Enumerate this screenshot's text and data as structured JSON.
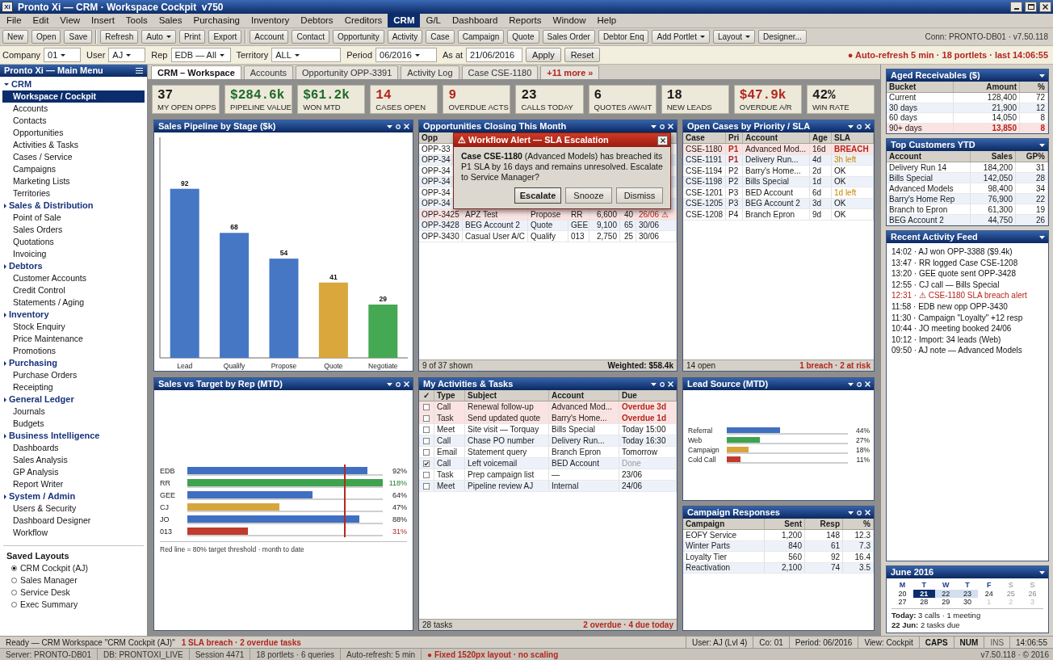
{
  "window": {
    "logo": "Xi",
    "title": "Pronto Xi — CRM · Workspace Cockpit  v750"
  },
  "menu": [
    {
      "label": "File",
      "selected": false
    },
    {
      "label": "Edit",
      "selected": false
    },
    {
      "label": "View",
      "selected": false
    },
    {
      "label": "Insert",
      "selected": false
    },
    {
      "label": "Tools",
      "selected": false
    },
    {
      "label": "Sales",
      "selected": false
    },
    {
      "label": "Purchasing",
      "selected": false
    },
    {
      "label": "Inventory",
      "selected": false
    },
    {
      "label": "Debtors",
      "selected": false
    },
    {
      "label": "Creditors",
      "selected": false
    },
    {
      "label": "CRM",
      "selected": true
    },
    {
      "label": "G/L",
      "selected": false
    },
    {
      "label": "Dashboard",
      "selected": false
    },
    {
      "label": "Reports",
      "selected": false
    },
    {
      "label": "Window",
      "selected": false
    },
    {
      "label": "Help",
      "selected": false
    }
  ],
  "toolbar": {
    "groups": [
      [
        {
          "label": "New",
          "dropdown": false
        },
        {
          "label": "Open",
          "dropdown": false
        },
        {
          "label": "Save",
          "dropdown": false
        }
      ],
      [
        {
          "label": "Refresh",
          "dropdown": false
        },
        {
          "label": "Auto",
          "dropdown": true
        },
        {
          "label": "Print",
          "dropdown": false
        },
        {
          "label": "Export",
          "dropdown": false
        }
      ],
      [
        {
          "label": "Account",
          "dropdown": false
        },
        {
          "label": "Contact",
          "dropdown": false
        },
        {
          "label": "Opportunity",
          "dropdown": false
        },
        {
          "label": "Activity",
          "dropdown": false
        },
        {
          "label": "Case",
          "dropdown": false
        },
        {
          "label": "Campaign",
          "dropdown": false
        },
        {
          "label": "Quote",
          "dropdown": false
        },
        {
          "label": "Sales Order",
          "dropdown": false
        },
        {
          "label": "Debtor Enq",
          "dropdown": false
        },
        {
          "label": "Add Portlet",
          "dropdown": true
        },
        {
          "label": "Layout",
          "dropdown": true
        },
        {
          "label": "Designer...",
          "dropdown": false
        }
      ]
    ],
    "connection": "Conn: PRONTO-DB01 · v7.50.118"
  },
  "filters": {
    "fields": [
      {
        "label": "Company",
        "value": "01",
        "kind": "select"
      },
      {
        "label": "User",
        "value": "AJ",
        "kind": "select"
      },
      {
        "label": "Rep",
        "value": "EDB — All",
        "kind": "select"
      },
      {
        "label": "Territory",
        "value": "ALL",
        "kind": "select"
      },
      {
        "label": "Period",
        "value": "06/2016",
        "kind": "select"
      },
      {
        "label": "As at",
        "value": "21/06/2016",
        "kind": "input"
      }
    ],
    "buttons": [
      "Apply",
      "Reset"
    ],
    "status": "● Auto-refresh 5 min · 18 portlets · last 14:06:55"
  },
  "sidebar": {
    "title": "Pronto Xi — Main Menu",
    "groups": [
      {
        "label": "CRM",
        "expanded": true,
        "children": [
          {
            "label": "Workspace / Cockpit",
            "selected": true
          },
          {
            "label": "Accounts",
            "selected": false
          },
          {
            "label": "Contacts",
            "selected": false
          },
          {
            "label": "Opportunities",
            "selected": false
          },
          {
            "label": "Activities & Tasks",
            "selected": false
          },
          {
            "label": "Cases / Service",
            "selected": false
          },
          {
            "label": "Campaigns",
            "selected": false
          },
          {
            "label": "Marketing Lists",
            "selected": false
          },
          {
            "label": "Territories",
            "selected": false
          }
        ]
      },
      {
        "label": "Sales & Distribution",
        "expanded": false,
        "children": [
          {
            "label": "Point of Sale",
            "selected": false
          },
          {
            "label": "Sales Orders",
            "selected": false
          },
          {
            "label": "Quotations",
            "selected": false
          },
          {
            "label": "Invoicing",
            "selected": false
          }
        ]
      },
      {
        "label": "Debtors",
        "expanded": false,
        "children": [
          {
            "label": "Customer Accounts",
            "selected": false
          },
          {
            "label": "Credit Control",
            "selected": false
          },
          {
            "label": "Statements / Aging",
            "selected": false
          }
        ]
      },
      {
        "label": "Inventory",
        "expanded": false,
        "children": [
          {
            "label": "Stock Enquiry",
            "selected": false
          },
          {
            "label": "Price Maintenance",
            "selected": false
          },
          {
            "label": "Promotions",
            "selected": false
          }
        ]
      },
      {
        "label": "Purchasing",
        "expanded": false,
        "children": [
          {
            "label": "Purchase Orders",
            "selected": false
          },
          {
            "label": "Receipting",
            "selected": false
          }
        ]
      },
      {
        "label": "General Ledger",
        "expanded": false,
        "children": [
          {
            "label": "Journals",
            "selected": false
          },
          {
            "label": "Budgets",
            "selected": false
          }
        ]
      },
      {
        "label": "Business Intelligence",
        "expanded": false,
        "children": [
          {
            "label": "Dashboards",
            "selected": false
          },
          {
            "label": "Sales Analysis",
            "selected": false
          },
          {
            "label": "GP Analysis",
            "selected": false
          },
          {
            "label": "Report Writer",
            "selected": false
          }
        ]
      },
      {
        "label": "System / Admin",
        "expanded": false,
        "children": [
          {
            "label": "Users & Security",
            "selected": false
          },
          {
            "label": "Dashboard Designer",
            "selected": false
          },
          {
            "label": "Workflow",
            "selected": false
          }
        ]
      }
    ],
    "saved_layouts": {
      "title": "Saved Layouts",
      "items": [
        {
          "label": "CRM Cockpit (AJ)",
          "selected": true
        },
        {
          "label": "Sales Manager",
          "selected": false
        },
        {
          "label": "Service Desk",
          "selected": false
        },
        {
          "label": "Exec Summary",
          "selected": false
        }
      ]
    }
  },
  "tabs": [
    {
      "label": "CRM – Workspace",
      "selected": true
    },
    {
      "label": "Accounts",
      "selected": false
    },
    {
      "label": "Opportunity OPP-3391",
      "selected": false
    },
    {
      "label": "Activity Log",
      "selected": false
    },
    {
      "label": "Case CSE-1180",
      "selected": false
    }
  ],
  "tabs_more": "+11 more »",
  "kpis": [
    {
      "value": "37",
      "label": "MY OPEN OPPS",
      "color": "#1a1a1a"
    },
    {
      "value": "$284.6k",
      "label": "PIPELINE VALUE",
      "color": "#1e6b2a"
    },
    {
      "value": "$61.2k",
      "label": "WON MTD",
      "color": "#1e6b2a"
    },
    {
      "value": "14",
      "label": "CASES OPEN",
      "color": "#b3261e"
    },
    {
      "value": "9",
      "label": "OVERDUE ACTS",
      "color": "#b3261e"
    },
    {
      "value": "23",
      "label": "CALLS TODAY",
      "color": "#1a1a1a"
    },
    {
      "value": "6",
      "label": "QUOTES AWAIT",
      "color": "#1a1a1a"
    },
    {
      "value": "18",
      "label": "NEW LEADS",
      "color": "#1a1a1a"
    },
    {
      "value": "$47.9k",
      "label": "OVERDUE A/R",
      "color": "#b3261e"
    },
    {
      "value": "42%",
      "label": "WIN RATE",
      "color": "#1a1a1a"
    }
  ],
  "pipeline": {
    "title": "Sales Pipeline by Stage ($k)",
    "bars": [
      {
        "color": "#4677c4"
      },
      {
        "color": "#4677c4"
      },
      {
        "color": "#4677c4"
      },
      {
        "color": "#d9a73c"
      },
      {
        "color": "#45a853"
      }
    ],
    "chart_data": {
      "type": "bar",
      "categories": [
        "Lead",
        "Qualify",
        "Propose",
        "Quote",
        "Negotiate"
      ],
      "values": [
        92,
        68,
        54,
        41,
        29
      ],
      "ylim": [
        0,
        120
      ],
      "data_labels": true
    }
  },
  "opportunities": {
    "title": "Opportunities Closing This Month",
    "columns": [
      "Opp"
    ],
    "rows": [
      {
        "cells": [
          "OPP-33"
        ],
        "overdue": false
      },
      {
        "cells": [
          "OPP-34"
        ],
        "overdue": false
      },
      {
        "cells": [
          "OPP-34"
        ],
        "overdue": false
      },
      {
        "cells": [
          "OPP-34"
        ],
        "overdue": false
      },
      {
        "cells": [
          "OPP-34"
        ],
        "overdue": false
      },
      {
        "cells": [
          "OPP-34"
        ],
        "overdue": false
      },
      {
        "cells": [
          "OPP-3425",
          "APZ Test",
          "Propose",
          "RR",
          "6,600",
          "40",
          "26/06 ⚠"
        ],
        "overdue": true
      },
      {
        "cells": [
          "OPP-3428",
          "BEG Account 2",
          "Quote",
          "GEE",
          "9,100",
          "65",
          "30/06"
        ],
        "overdue": false
      },
      {
        "cells": [
          "OPP-3430",
          "Casual User A/C",
          "Qualify",
          "013",
          "2,750",
          "25",
          "30/06"
        ],
        "overdue": false
      }
    ],
    "footer_left": "9 of 37 shown",
    "footer_right": "Weighted: $58.4k",
    "footer_alert": false
  },
  "alert": {
    "title": "⚠ Workflow Alert — SLA Escalation",
    "message": "**Case CSE-1180** (Advanced Models) has breached its P1 SLA by 16 days and remains unresolved. Escalate to Service Manager?",
    "buttons": [
      {
        "label": "Escalate",
        "default": true
      },
      {
        "label": "Snooze",
        "default": false
      },
      {
        "label": "Dismiss",
        "default": false
      }
    ]
  },
  "cases": {
    "title": "Open Cases by Priority / SLA",
    "columns": [
      "Case",
      "Pri",
      "Account",
      "Age",
      "SLA"
    ],
    "rows": [
      {
        "cells": [
          "CSE-1180",
          "P1",
          "Advanced Mod...",
          "16d",
          "BREACH"
        ],
        "urgent": true,
        "breached": true,
        "at_risk": false
      },
      {
        "cells": [
          "CSE-1191",
          "P1",
          "Delivery Run...",
          "4d",
          "3h left"
        ],
        "urgent": true,
        "breached": false,
        "at_risk": true
      },
      {
        "cells": [
          "CSE-1194",
          "P2",
          "Barry's Home...",
          "2d",
          "OK"
        ],
        "urgent": false,
        "breached": false,
        "at_risk": false
      },
      {
        "cells": [
          "CSE-1198",
          "P2",
          "Bills Special",
          "1d",
          "OK"
        ],
        "urgent": false,
        "breached": false,
        "at_risk": false
      },
      {
        "cells": [
          "CSE-1201",
          "P3",
          "BED Account",
          "6d",
          "1d left"
        ],
        "urgent": false,
        "breached": false,
        "at_risk": true
      },
      {
        "cells": [
          "CSE-1205",
          "P3",
          "BEG Account 2",
          "3d",
          "OK"
        ],
        "urgent": false,
        "breached": false,
        "at_risk": false
      },
      {
        "cells": [
          "CSE-1208",
          "P4",
          "Branch Epron",
          "9d",
          "OK"
        ],
        "urgent": false,
        "breached": false,
        "at_risk": false
      }
    ],
    "footer_left": "14 open",
    "footer_right": "1 breach · 2 at risk",
    "footer_alert": true
  },
  "sales_target": {
    "title": "Sales vs Target by Rep (MTD)",
    "target": {
      "level": 0.8
    },
    "reps": [
      {
        "name": "EDB",
        "level": 0.92,
        "reading": "92%",
        "color": "#3f6fc1",
        "over_target": false,
        "critical": false
      },
      {
        "name": "RR",
        "level": 1,
        "reading": "118%",
        "color": "#3ea34e",
        "over_target": true,
        "critical": false
      },
      {
        "name": "GEE",
        "level": 0.64,
        "reading": "64%",
        "color": "#3f6fc1",
        "over_target": false,
        "critical": false
      },
      {
        "name": "CJ",
        "level": 0.47,
        "reading": "47%",
        "color": "#d8a53c",
        "over_target": false,
        "critical": false
      },
      {
        "name": "JO",
        "level": 0.88,
        "reading": "88%",
        "color": "#3f6fc1",
        "over_target": false,
        "critical": false
      },
      {
        "name": "013",
        "level": 0.31,
        "reading": "31%",
        "color": "#c03a2e",
        "over_target": false,
        "critical": true
      }
    ],
    "note": "Red line = 80% target threshold · month to date"
  },
  "activities": {
    "title": "My Activities & Tasks",
    "check_header": "✓",
    "columns": [
      "Type",
      "Subject",
      "Account",
      "Due"
    ],
    "rows": [
      {
        "checked": false,
        "overdue": true,
        "cells": [
          "Call",
          "Renewal follow-up",
          "Advanced Mod...",
          "Overdue 3d"
        ]
      },
      {
        "checked": false,
        "overdue": true,
        "cells": [
          "Task",
          "Send updated quote",
          "Barry's Home...",
          "Overdue 1d"
        ]
      },
      {
        "checked": false,
        "overdue": false,
        "cells": [
          "Meet",
          "Site visit — Torquay",
          "Bills Special",
          "Today 15:00"
        ]
      },
      {
        "checked": false,
        "overdue": false,
        "cells": [
          "Call",
          "Chase PO number",
          "Delivery Run...",
          "Today 16:30"
        ]
      },
      {
        "checked": false,
        "overdue": false,
        "cells": [
          "Email",
          "Statement query",
          "Branch Epron",
          "Tomorrow"
        ]
      },
      {
        "checked": true,
        "overdue": false,
        "cells": [
          "Call",
          "Left voicemail",
          "BED Account",
          "Done"
        ]
      },
      {
        "checked": false,
        "overdue": false,
        "cells": [
          "Task",
          "Prep campaign list",
          "—",
          "23/06"
        ]
      },
      {
        "checked": false,
        "overdue": false,
        "cells": [
          "Meet",
          "Pipeline review AJ",
          "Internal",
          "24/06"
        ]
      }
    ],
    "footer_left": "28 tasks",
    "footer_right": "2 overdue · 4 due today",
    "footer_alert": true
  },
  "lead_source": {
    "title": "Lead Source (MTD)",
    "sources": [
      {
        "name": "Referral",
        "level": 0.44,
        "reading": "44%",
        "color": "#3f6fc1"
      },
      {
        "name": "Web",
        "level": 0.27,
        "reading": "27%",
        "color": "#3ea34e"
      },
      {
        "name": "Campaign",
        "level": 0.18,
        "reading": "18%",
        "color": "#d8a53c"
      },
      {
        "name": "Cold Call",
        "level": 0.11,
        "reading": "11%",
        "color": "#c03a2e"
      }
    ]
  },
  "campaigns": {
    "title": "Campaign Responses",
    "columns": [
      "Campaign",
      "Sent",
      "Resp",
      "%"
    ],
    "rows": [
      [
        "EOFY Service",
        "1,200",
        "148",
        "12.3"
      ],
      [
        "Winter Parts",
        "840",
        "61",
        "7.3"
      ],
      [
        "Loyalty Tier",
        "560",
        "92",
        "16.4"
      ],
      [
        "Reactivation",
        "2,100",
        "74",
        "3.5"
      ]
    ]
  },
  "aged": {
    "title": "Aged Receivables ($)",
    "columns": [
      "Bucket",
      "Amount",
      "%"
    ],
    "rows": [
      {
        "cells": [
          "Current",
          "128,400",
          "72"
        ],
        "overdue": false
      },
      {
        "cells": [
          "30 days",
          "21,900",
          "12"
        ],
        "overdue": false
      },
      {
        "cells": [
          "60 days",
          "14,050",
          "8"
        ],
        "overdue": false
      },
      {
        "cells": [
          "90+ days",
          "13,850",
          "8"
        ],
        "overdue": true
      }
    ]
  },
  "top_customers": {
    "title": "Top Customers YTD",
    "columns": [
      "Account",
      "Sales",
      "GP%"
    ],
    "rows": [
      [
        "Delivery Run 14",
        "184,200",
        "31"
      ],
      [
        "Bills Special",
        "142,050",
        "28"
      ],
      [
        "Advanced Models",
        "98,400",
        "34"
      ],
      [
        "Barry's Home Rep",
        "76,900",
        "22"
      ],
      [
        "Branch to Epron",
        "61,300",
        "19"
      ],
      [
        "BEG Account 2",
        "44,750",
        "26"
      ]
    ]
  },
  "feed": {
    "title": "Recent Activity Feed",
    "items": [
      {
        "text": "14:02 · AJ won OPP-3388 ($9.4k)",
        "alert": false
      },
      {
        "text": "13:47 · RR logged Case CSE-1208",
        "alert": false
      },
      {
        "text": "13:20 · GEE quote sent OPP-3428",
        "alert": false
      },
      {
        "text": "12:55 · CJ call — Bills Special",
        "alert": false
      },
      {
        "text": "12:31 · ⚠ CSE-1180 SLA breach alert",
        "alert": true
      },
      {
        "text": "11:58 · EDB new opp OPP-3430",
        "alert": false
      },
      {
        "text": "11:30 · Campaign \"Loyalty\" +12 resp",
        "alert": false
      },
      {
        "text": "10:44 · JO meeting booked 24/06",
        "alert": false
      },
      {
        "text": "10:12 · Import: 34 leads (Web)",
        "alert": false
      },
      {
        "text": "09:50 · AJ note — Advanced Models",
        "alert": false
      }
    ]
  },
  "calendar": {
    "title": "June 2016",
    "weekdays": [
      {
        "label": "M",
        "weekend": false
      },
      {
        "label": "T",
        "weekend": false
      },
      {
        "label": "W",
        "weekend": false
      },
      {
        "label": "T",
        "weekend": false
      },
      {
        "label": "F",
        "weekend": false
      },
      {
        "label": "S",
        "weekend": true
      },
      {
        "label": "S",
        "weekend": true
      }
    ],
    "weeks": [
      [
        {
          "day": "20",
          "selected": false,
          "marked": false,
          "kind": "day"
        },
        {
          "day": "21",
          "selected": true,
          "marked": false,
          "kind": "day"
        },
        {
          "day": "22",
          "selected": false,
          "marked": true,
          "kind": "day"
        },
        {
          "day": "23",
          "selected": false,
          "marked": true,
          "kind": "day"
        },
        {
          "day": "24",
          "selected": false,
          "marked": false,
          "kind": "day"
        },
        {
          "day": "25",
          "selected": false,
          "marked": false,
          "kind": "weekend"
        },
        {
          "day": "26",
          "selected": false,
          "marked": false,
          "kind": "weekend"
        }
      ],
      [
        {
          "day": "27",
          "selected": false,
          "marked": false,
          "kind": "day"
        },
        {
          "day": "28",
          "selected": false,
          "marked": false,
          "kind": "day"
        },
        {
          "day": "29",
          "selected": false,
          "marked": false,
          "kind": "day"
        },
        {
          "day": "30",
          "selected": false,
          "marked": false,
          "kind": "day"
        },
        {
          "day": "1",
          "selected": false,
          "marked": false,
          "kind": "next_month"
        },
        {
          "day": "2",
          "selected": false,
          "marked": false,
          "kind": "next_month"
        },
        {
          "day": "3",
          "selected": false,
          "marked": false,
          "kind": "next_month"
        }
      ]
    ],
    "notes": [
      "**Today:** 3 calls · 1 meeting",
      "**22 Jun:** 2 tasks due"
    ]
  },
  "status_bar": {
    "message": "Ready — CRM Workspace \"CRM Cockpit (AJ)\"",
    "alert": "1 SLA breach · 2 overdue tasks",
    "fields": [
      "User: AJ (Lvl 4)",
      "Co: 01",
      "Period: 06/2016",
      "View: Cockpit"
    ],
    "indicators": [
      {
        "label": "CAPS",
        "on": true
      },
      {
        "label": "NUM",
        "on": true
      },
      {
        "label": "INS",
        "on": false
      }
    ],
    "clock": "14:06:55"
  },
  "info_bar": {
    "fields": [
      "Server: PRONTO-DB01",
      "DB: PRONTOXI_LIVE",
      "Session 4471",
      "18 portlets · 6 queries",
      "Auto-refresh: 5 min"
    ],
    "alert": "● Fixed 1520px layout · no scaling",
    "version": "v7.50.118 · © 2016"
  }
}
